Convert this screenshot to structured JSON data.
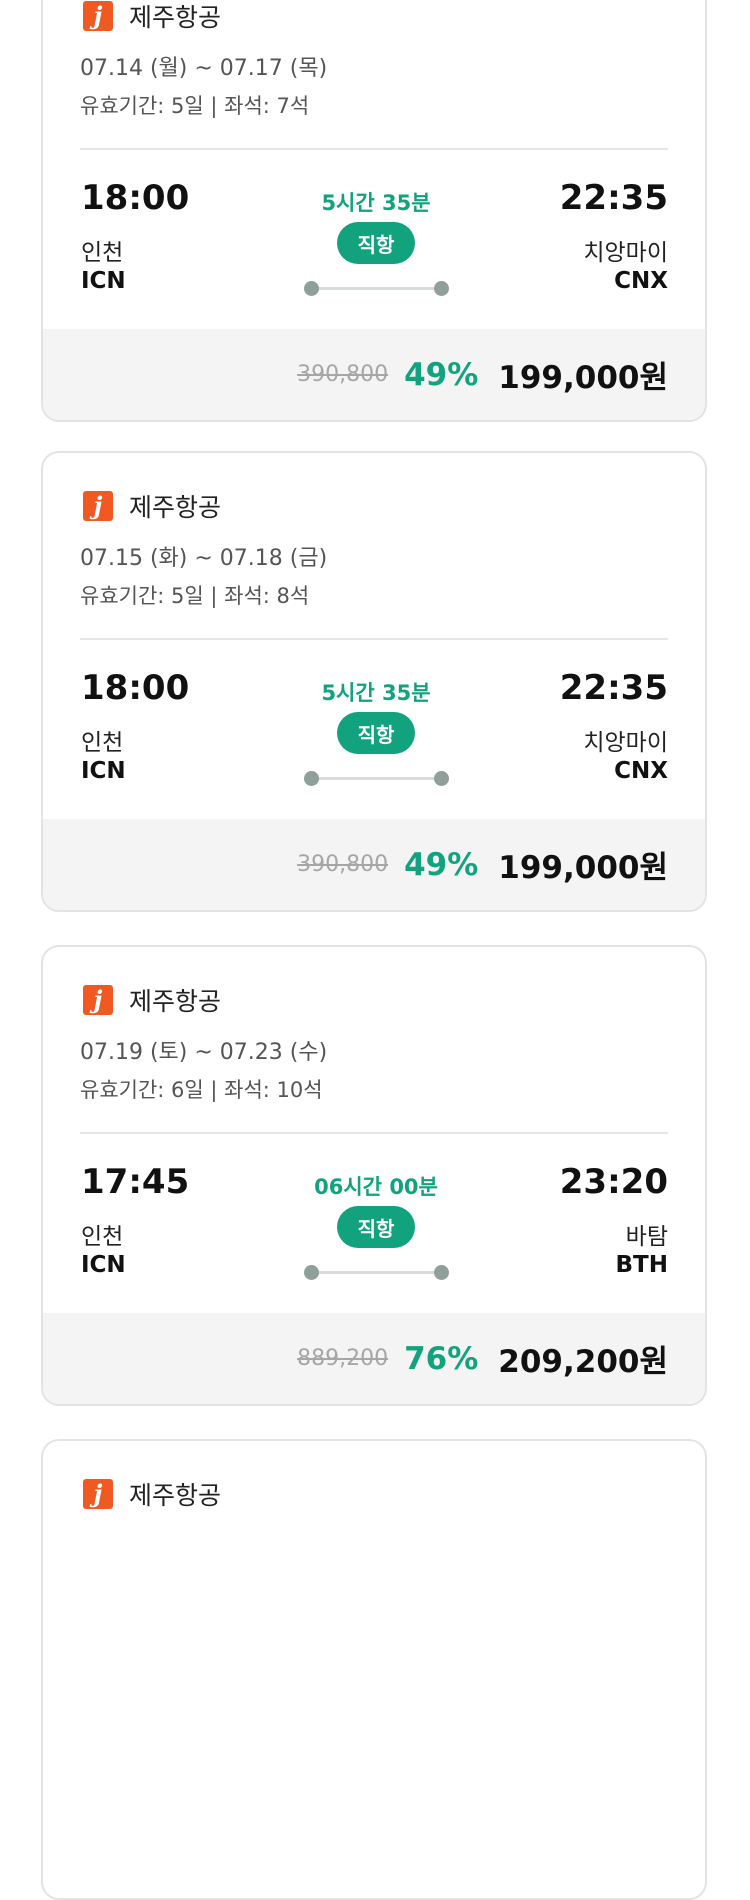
{
  "cards": [
    {
      "airline": "제주항공",
      "logo_letter": "j",
      "dates": "07.14 (월) ~ 07.17 (목)",
      "meta": "유효기간: 5일 | 좌석: 7석",
      "dep_time": "18:00",
      "dep_city": "인천",
      "dep_code": "ICN",
      "duration": "5시간 35분",
      "direct": "직항",
      "arr_time": "22:35",
      "arr_city": "치앙마이",
      "arr_code": "CNX",
      "orig_price": "390,800",
      "discount": "49%",
      "price": "199,000원"
    },
    {
      "airline": "제주항공",
      "logo_letter": "j",
      "dates": "07.15 (화) ~ 07.18 (금)",
      "meta": "유효기간: 5일 | 좌석: 8석",
      "dep_time": "18:00",
      "dep_city": "인천",
      "dep_code": "ICN",
      "duration": "5시간 35분",
      "direct": "직항",
      "arr_time": "22:35",
      "arr_city": "치앙마이",
      "arr_code": "CNX",
      "orig_price": "390,800",
      "discount": "49%",
      "price": "199,000원"
    },
    {
      "airline": "제주항공",
      "logo_letter": "j",
      "dates": "07.19 (토) ~ 07.23 (수)",
      "meta": "유효기간: 6일 | 좌석: 10석",
      "dep_time": "17:45",
      "dep_city": "인천",
      "dep_code": "ICN",
      "duration": "06시간 00분",
      "direct": "직항",
      "arr_time": "23:20",
      "arr_city": "바탐",
      "arr_code": "BTH",
      "orig_price": "889,200",
      "discount": "76%",
      "price": "209,200원"
    },
    {
      "airline": "제주항공",
      "logo_letter": "j"
    }
  ],
  "colors": {
    "accent_green": "#12a37e",
    "logo_orange": "#f05a22",
    "footer_bg": "#f4f4f4",
    "route_dot": "#8fa09a"
  },
  "icons": {
    "airline_logo": "jeju-air-logo-icon",
    "route_dot": "route-dot-icon"
  }
}
